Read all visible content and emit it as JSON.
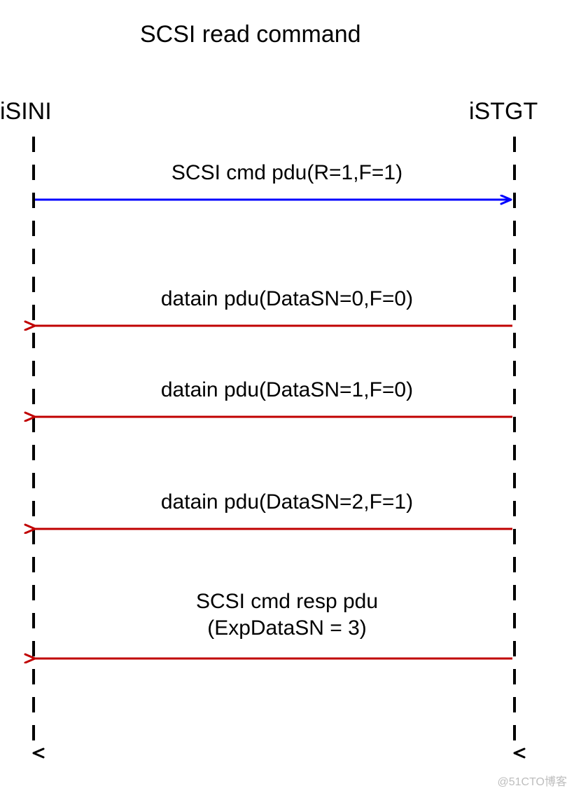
{
  "title": "SCSI read command",
  "left_endpoint": "iSINI",
  "right_endpoint": "iSTGT",
  "messages": {
    "m1": "SCSI cmd pdu(R=1,F=1)",
    "m2": "datain pdu(DataSN=0,F=0)",
    "m3": "datain pdu(DataSN=1,F=0)",
    "m4": "datain pdu(DataSN=2,F=1)",
    "m5a": "SCSI cmd resp pdu",
    "m5b": "(ExpDataSN = 3)"
  },
  "colors": {
    "blue": "#0000ff",
    "red": "#c00000",
    "black": "#000000"
  },
  "watermark": "@51CTO博客",
  "chart_data": {
    "type": "sequence",
    "title": "SCSI read command",
    "participants": [
      "iSINI",
      "iSTGT"
    ],
    "messages": [
      {
        "from": "iSINI",
        "to": "iSTGT",
        "label": "SCSI cmd pdu(R=1,F=1)",
        "color": "blue"
      },
      {
        "from": "iSTGT",
        "to": "iSINI",
        "label": "datain pdu(DataSN=0,F=0)",
        "color": "red"
      },
      {
        "from": "iSTGT",
        "to": "iSINI",
        "label": "datain pdu(DataSN=1,F=0)",
        "color": "red"
      },
      {
        "from": "iSTGT",
        "to": "iSINI",
        "label": "datain pdu(DataSN=2,F=1)",
        "color": "red"
      },
      {
        "from": "iSTGT",
        "to": "iSINI",
        "label": "SCSI cmd resp pdu (ExpDataSN = 3)",
        "color": "red"
      }
    ]
  }
}
